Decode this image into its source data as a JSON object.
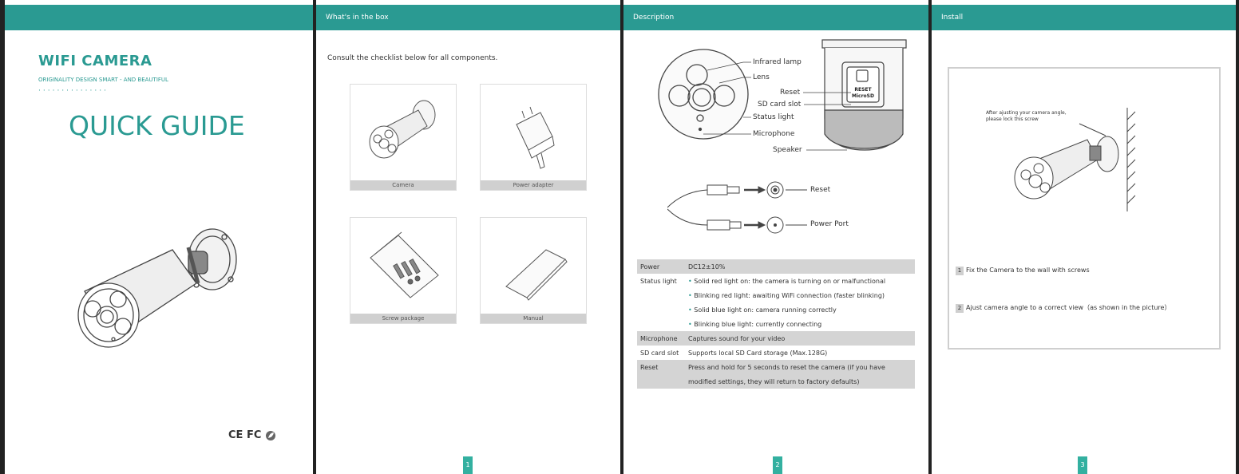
{
  "cover": {
    "brand": "WIFI CAMERA",
    "slogan": "ORIGINALITY DESIGN SMART - AND BEAUTIFUL",
    "dots": "···············",
    "title": "QUICK GUIDE",
    "cert": "CE FC"
  },
  "box": {
    "header": "What's in the box",
    "intro": "Consult the checklist below for all components.",
    "items": [
      "Camera",
      "Power adapter",
      "Screw package",
      "Manual"
    ],
    "page_number": "1"
  },
  "description": {
    "header": "Description",
    "callouts": [
      "Infrared lamp",
      "Lens",
      "Reset",
      "SD card slot",
      "Status light",
      "Microphone",
      "Speaker"
    ],
    "sd_label_1": "RESET",
    "sd_label_2": "MicroSD",
    "ports": [
      "Reset",
      "Power Port"
    ],
    "spec": {
      "power_key": "Power",
      "power_val": "DC12±10%",
      "status_key": "Status light",
      "status_1": "Solid red light on: the camera is turning on or malfunctional",
      "status_2": "Blinking red light: awaiting WiFi connection (faster blinking)",
      "status_3": "Solid blue light on: camera running correctly",
      "status_4": "Blinking blue light: currently connecting",
      "mic_key": "Microphone",
      "mic_val": "Captures sound for your video",
      "sd_key": "SD card slot",
      "sd_val": "Supports local SD Card storage (Max.128G)",
      "reset_key": "Reset",
      "reset_val_1": "Press and hold for 5 seconds to reset the camera (if you have",
      "reset_val_2": "modified settings, they will return to factory defaults)"
    },
    "page_number": "2"
  },
  "install": {
    "header": "Install",
    "note_1": "After ajusting your camera angle,",
    "note_2": "please lock this screw",
    "step1_n": "1",
    "step1": "Fix  the Camera to the wall with screws",
    "step2_n": "2",
    "step2": "Ajust camera angle to a correct view（as shown in the picture）",
    "page_number": "3"
  },
  "colors": {
    "accent": "#2a9a92",
    "page_tab": "#33b0a0"
  }
}
